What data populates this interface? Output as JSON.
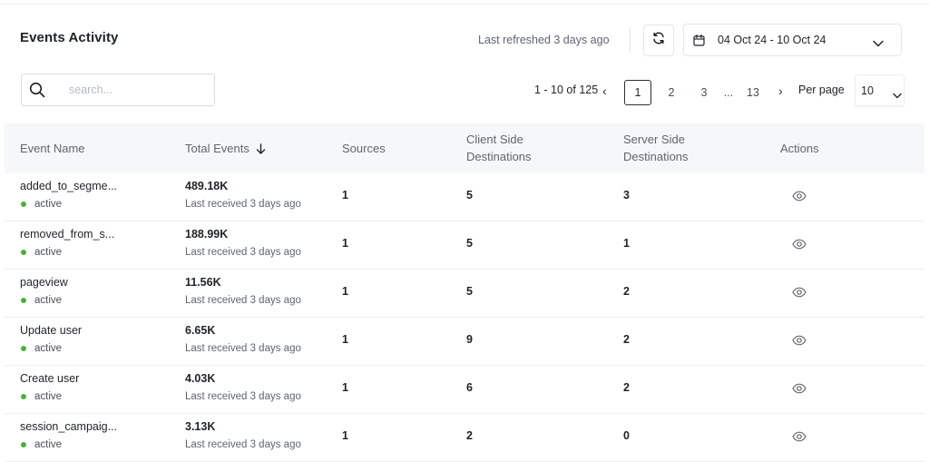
{
  "header": {
    "title": "Events Activity",
    "last_refreshed": "Last refreshed 3 days ago",
    "date_range": "04 Oct 24 - 10 Oct 24"
  },
  "search": {
    "placeholder": "search...",
    "value": ""
  },
  "pagination": {
    "range_text": "1 - 10 of 125",
    "pages": [
      "1",
      "2",
      "3",
      "...",
      "13"
    ],
    "current_page": "1",
    "per_page_label": "Per page",
    "per_page_value": "10"
  },
  "table": {
    "columns": {
      "event_name": "Event Name",
      "total_events": "Total Events",
      "sources": "Sources",
      "client_side_line1": "Client Side",
      "client_side_line2": "Destinations",
      "server_side_line1": "Server Side",
      "server_side_line2": "Destinations",
      "actions": "Actions"
    },
    "rows": [
      {
        "name": "added_to_segme...",
        "status": "active",
        "total": "489.18K",
        "received": "Last received 3 days ago",
        "sources": "1",
        "client": "5",
        "server": "3"
      },
      {
        "name": "removed_from_s...",
        "status": "active",
        "total": "188.99K",
        "received": "Last received 3 days ago",
        "sources": "1",
        "client": "5",
        "server": "1"
      },
      {
        "name": "pageview",
        "status": "active",
        "total": "11.56K",
        "received": "Last received 3 days ago",
        "sources": "1",
        "client": "5",
        "server": "2"
      },
      {
        "name": "Update user",
        "status": "active",
        "total": "6.65K",
        "received": "Last received 3 days ago",
        "sources": "1",
        "client": "9",
        "server": "2"
      },
      {
        "name": "Create user",
        "status": "active",
        "total": "4.03K",
        "received": "Last received 3 days ago",
        "sources": "1",
        "client": "6",
        "server": "2"
      },
      {
        "name": "session_campaig...",
        "status": "active",
        "total": "3.13K",
        "received": "Last received 3 days ago",
        "sources": "1",
        "client": "2",
        "server": "0"
      }
    ]
  },
  "colors": {
    "active_dot": "#4caf3a",
    "header_bg": "#f6f7f8",
    "border": "#eceef1"
  },
  "icons": {
    "refresh": "refresh-icon",
    "calendar": "calendar-icon",
    "dropdown": "chevron-down-icon",
    "search": "search-icon",
    "sort": "arrow-down-icon",
    "view": "eye-icon",
    "prev": "chevron-left-icon",
    "next": "chevron-right-icon"
  }
}
